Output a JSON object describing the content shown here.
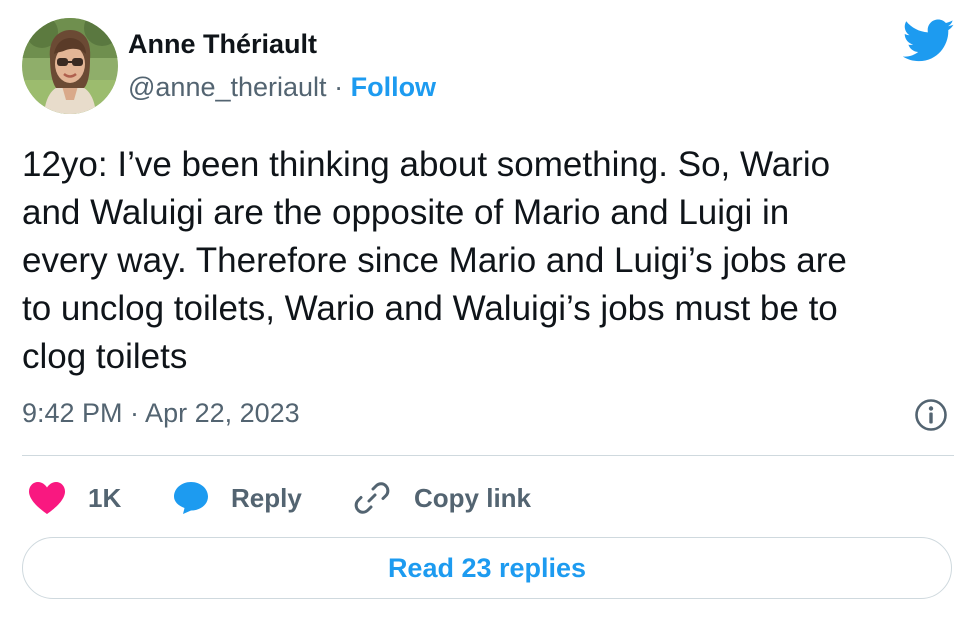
{
  "author": {
    "name": "Anne Thériault",
    "handle": "@anne_theriault",
    "separator": "·",
    "follow_label": "Follow",
    "avatar_icon": "profile-photo"
  },
  "brand": {
    "icon": "twitter-bird-icon",
    "color": "#1d9bf0"
  },
  "tweet": {
    "text": "12yo: I’ve been thinking about something. So, Wario\nand Waluigi are the opposite of Mario and Luigi in\nevery way. Therefore since Mario and Luigi’s jobs are\nto unclog toilets, Wario and Waluigi’s jobs must be to\nclog toilets",
    "timestamp": "9:42 PM · Apr 22, 2023"
  },
  "actions": {
    "like": {
      "icon": "heart-icon",
      "count": "1K",
      "color": "#f91880"
    },
    "reply": {
      "icon": "speech-bubble-icon",
      "label": "Reply",
      "color": "#1d9bf0"
    },
    "copy_link": {
      "icon": "link-icon",
      "label": "Copy link"
    }
  },
  "info_icon": "info-icon",
  "read_replies": {
    "label": "Read 23 replies"
  },
  "colors": {
    "text": "#0f1419",
    "secondary": "#536471",
    "accent": "#1d9bf0",
    "border": "#cfd9de"
  }
}
